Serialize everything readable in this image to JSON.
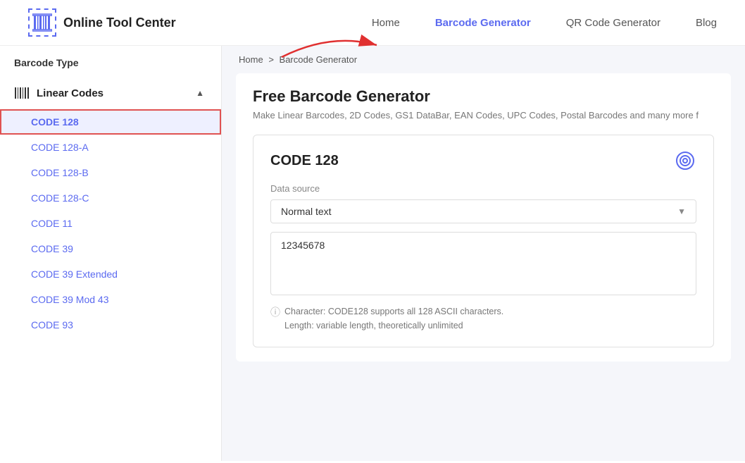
{
  "header": {
    "logo_icon": "▌▌▌▌",
    "logo_text": "Online Tool Center",
    "nav": [
      {
        "label": "Home",
        "active": false
      },
      {
        "label": "Barcode Generator",
        "active": true
      },
      {
        "label": "QR Code Generator",
        "active": false
      },
      {
        "label": "Blog",
        "active": false
      }
    ]
  },
  "breadcrumb": {
    "home": "Home",
    "separator": ">",
    "current": "Barcode Generator"
  },
  "page": {
    "title": "Free Barcode Generator",
    "subtitle": "Make Linear Barcodes, 2D Codes, GS1 DataBar, EAN Codes, UPC Codes, Postal Barcodes and many more f"
  },
  "sidebar": {
    "section_label": "Barcode Type",
    "linear_codes_label": "Linear Codes",
    "items": [
      {
        "label": "CODE 128",
        "selected": true
      },
      {
        "label": "CODE 128-A",
        "selected": false
      },
      {
        "label": "CODE 128-B",
        "selected": false
      },
      {
        "label": "CODE 128-C",
        "selected": false
      },
      {
        "label": "CODE 11",
        "selected": false
      },
      {
        "label": "CODE 39",
        "selected": false
      },
      {
        "label": "CODE 39 Extended",
        "selected": false
      },
      {
        "label": "CODE 39 Mod 43",
        "selected": false
      },
      {
        "label": "CODE 93",
        "selected": false
      }
    ]
  },
  "code_panel": {
    "title": "CODE 128",
    "data_source_label": "Data source",
    "dropdown_value": "Normal text",
    "textarea_value": "12345678",
    "info_line1": "Character: CODE128 supports all 128 ASCII characters.",
    "info_line2": "Length: variable length, theoretically unlimited"
  }
}
